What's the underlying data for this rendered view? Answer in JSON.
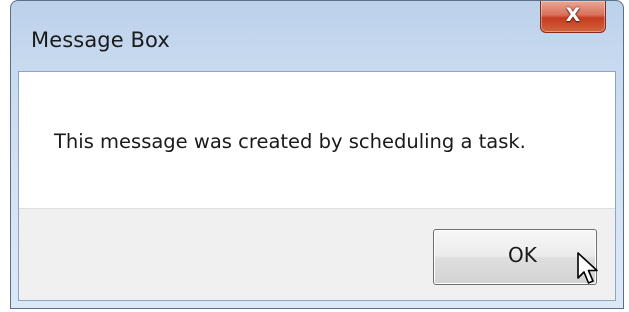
{
  "window": {
    "title": "Message Box",
    "close_label": "X"
  },
  "dialog": {
    "message": "This message was created by scheduling a task.",
    "ok_label": "OK"
  },
  "icons": {
    "close": "close-icon",
    "cursor": "mouse-pointer-icon"
  },
  "colors": {
    "close_button": "#c43c20",
    "frame": "#c9dbf0"
  }
}
